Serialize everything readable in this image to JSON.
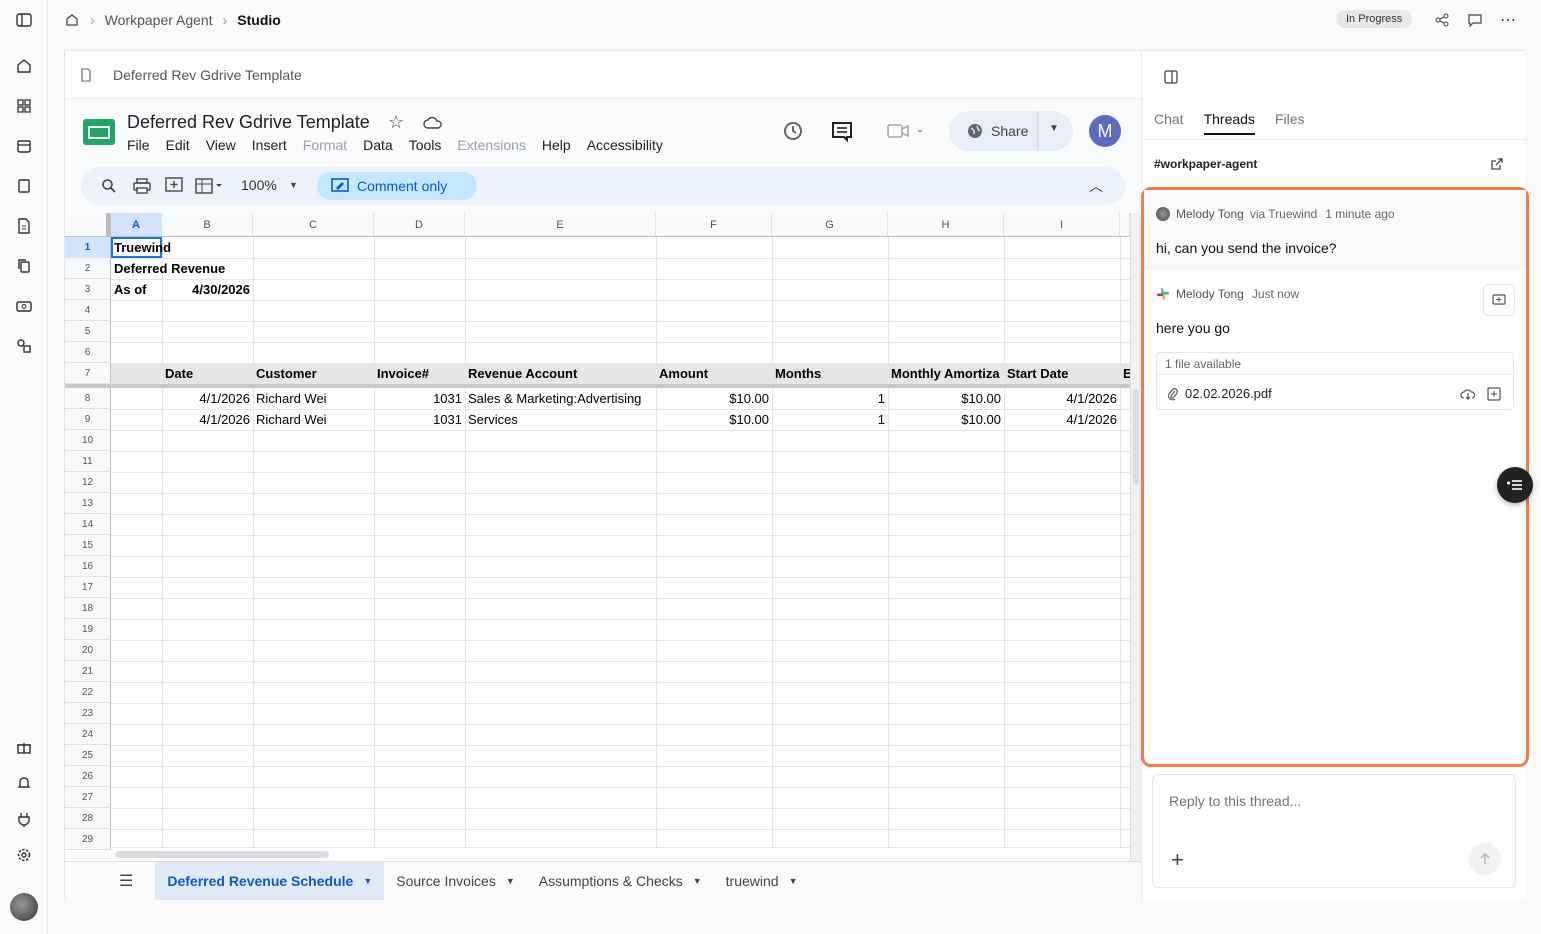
{
  "breadcrumb": {
    "parent": "Workpaper Agent",
    "current": "Studio"
  },
  "status_badge": "In Progress",
  "doc_header_title": "Deferred Rev Gdrive Template",
  "sheets": {
    "title": "Deferred Rev Gdrive Template",
    "menu": [
      "File",
      "Edit",
      "View",
      "Insert",
      "Format",
      "Data",
      "Tools",
      "Extensions",
      "Help",
      "Accessibility"
    ],
    "zoom": "100%",
    "mode_label": "Comment only",
    "share_label": "Share",
    "avatar_initial": "M",
    "columns": [
      "A",
      "B",
      "C",
      "D",
      "E",
      "F",
      "G",
      "H",
      "I"
    ],
    "rows": [
      "1",
      "2",
      "3",
      "4",
      "5",
      "6",
      "7",
      "8",
      "9",
      "10",
      "11",
      "12",
      "13",
      "14",
      "15",
      "16",
      "17",
      "18",
      "19",
      "20",
      "21",
      "22",
      "23",
      "24",
      "25",
      "26",
      "27",
      "28",
      "29"
    ],
    "cells": {
      "a1": "Truewind",
      "a2": "Deferred Revenue",
      "a3": "As of",
      "b3": "4/30/2026",
      "headers": [
        "Date",
        "Customer",
        "Invoice#",
        "Revenue Account",
        "Amount",
        "Months",
        "Monthly Amortiza",
        "Start Date",
        "E"
      ],
      "data_rows": [
        [
          "4/1/2026",
          "Richard Wei",
          "1031",
          "Sales & Marketing:Advertising",
          "$10.00",
          "1",
          "$10.00",
          "4/1/2026"
        ],
        [
          "4/1/2026",
          "Richard Wei",
          "1031",
          "Services",
          "$10.00",
          "1",
          "$10.00",
          "4/1/2026"
        ]
      ]
    },
    "sheet_tabs": [
      "Deferred Revenue Schedule",
      "Source Invoices",
      "Assumptions & Checks",
      "truewind"
    ]
  },
  "panel": {
    "tabs": [
      "Chat",
      "Threads",
      "Files"
    ],
    "channel": "#workpaper-agent",
    "messages": [
      {
        "author": "Melody Tong",
        "via": "via Truewind",
        "time": "1 minute ago",
        "text": "hi, can you send the invoice?"
      },
      {
        "author": "Melody Tong",
        "via": "",
        "time": "Just now",
        "text": "here you go"
      }
    ],
    "files_header": "1 file available",
    "file_name": "02.02.2026.pdf",
    "reply_placeholder": "Reply to this thread..."
  },
  "colors": {
    "accent_orange": "#f47c46",
    "sheets_blue": "#0b57d0",
    "sheets_chip": "#c2e7ff"
  }
}
